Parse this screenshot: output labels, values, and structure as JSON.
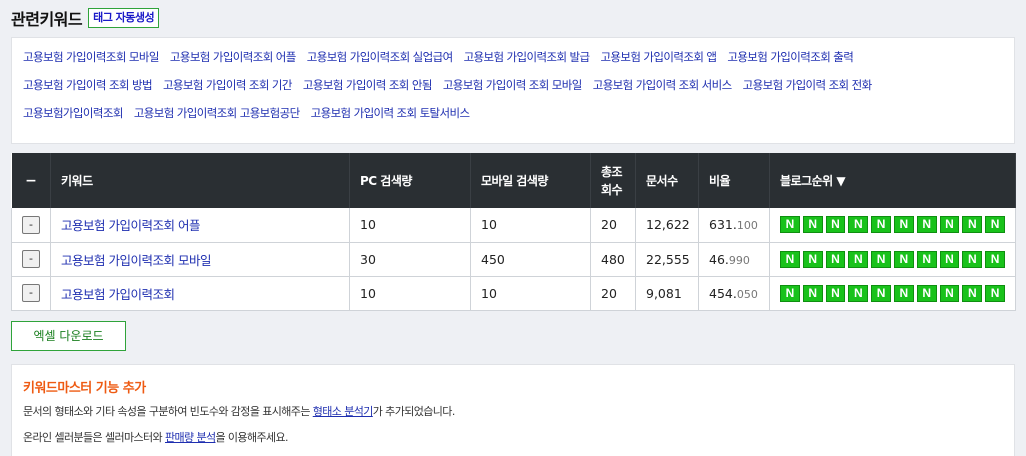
{
  "header": {
    "title": "관련키워드",
    "tag_button": "태그 자동생성"
  },
  "keyword_rows": [
    [
      "고용보험 가입이력조회 모바일",
      "고용보험 가입이력조회 어플",
      "고용보험 가입이력조회 실업급여",
      "고용보험 가입이력조회 발급",
      "고용보험 가입이력조회 앱",
      "고용보험 가입이력조회 출력"
    ],
    [
      "고용보험 가입이력 조회 방법",
      "고용보험 가입이력 조회 기간",
      "고용보험 가입이력 조회 안됨",
      "고용보험 가입이력 조회 모바일",
      "고용보험 가입이력 조회 서비스",
      "고용보험 가입이력 조회 전화"
    ],
    [
      "고용보험가입이력조회",
      "고용보험 가입이력조회 고용보험공단",
      "고용보험 가입이력 조회 토탈서비스"
    ]
  ],
  "table": {
    "headers": {
      "minus": "−",
      "keyword": "키워드",
      "pc": "PC 검색량",
      "mobile": "모바일 검색량",
      "total_line1": "총조",
      "total_line2": "회수",
      "docs": "문서수",
      "ratio": "비율",
      "blog_rank": "블로그순위 ▼"
    },
    "minus_button": "-",
    "badge_letter": "N",
    "rows": [
      {
        "keyword": "고용보험 가입이력조회 어플",
        "pc": "10",
        "mobile": "10",
        "total": "20",
        "docs": "12,622",
        "ratio_int": "631.",
        "ratio_dec": "100",
        "badges": 10
      },
      {
        "keyword": "고용보험 가입이력조회 모바일",
        "pc": "30",
        "mobile": "450",
        "total": "480",
        "docs": "22,555",
        "ratio_int": "46.",
        "ratio_dec": "990",
        "badges": 10
      },
      {
        "keyword": "고용보험 가입이력조회",
        "pc": "10",
        "mobile": "10",
        "total": "20",
        "docs": "9,081",
        "ratio_int": "454.",
        "ratio_dec": "050",
        "badges": 10
      }
    ]
  },
  "excel_button": "엑셀 다운로드",
  "notice": {
    "title": "키워드마스터 기능 추가",
    "line1_before": "문서의 형태소와 기타 속성을 구분하여 빈도수와 감정을 표시해주는 ",
    "line1_link": "형태소 분석기",
    "line1_after": "가 추가되었습니다.",
    "line2_before": "온라인 셀러분들은 셀러마스터와 ",
    "line2_link": "판매량 분석",
    "line2_after": "을 이용해주세요."
  },
  "colors": {
    "badge_green": "#19c21b",
    "link_blue": "#1f2fb0",
    "notice_orange": "#ee5a12",
    "header_dark": "#2a2f33"
  }
}
